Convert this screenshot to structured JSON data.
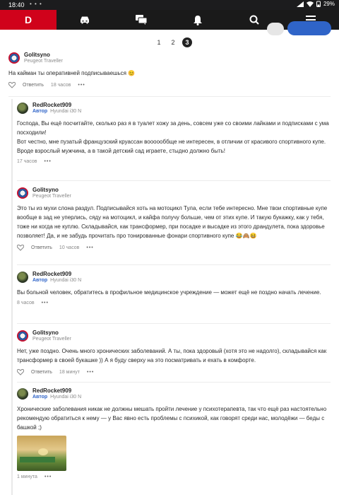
{
  "status_bar": {
    "time": "18:40",
    "battery": "29%",
    "dots": "• • •"
  },
  "navbar": {
    "logo": "D",
    "icons": [
      "car-icon",
      "chat-icon",
      "bell-icon",
      "search-icon",
      "menu-icon"
    ]
  },
  "pagination": {
    "pages": [
      "1",
      "2",
      "3"
    ],
    "active": "3"
  },
  "comments": [
    {
      "author": "Golitsyno",
      "car": "Peugeot Traveller",
      "is_author": false,
      "text": "На кайман ты оперативней подписываешься 😊",
      "reply_label": "Ответить",
      "time": "18 часов",
      "more": "•••"
    },
    {
      "author": "RedRocket909",
      "author_badge": "Автор",
      "car": "Hyundai i30 N",
      "is_author": true,
      "text": "Господа, Вы ещё посчитайте, сколько раз я в туалет хожу за день, совсем уже со своими лайками и подписками с ума посходили!\nВот честно, мне пузатый французский круассан воооооббще не интересен, в отличии от красивого спортивного купе.\nВроде взрослый мужчина, а в такой детский сад играете, стыдно должно быть!",
      "time": "17 часов",
      "more": "•••"
    },
    {
      "author": "Golitsyno",
      "car": "Peugeot Traveller",
      "is_author": false,
      "text": "Это ты из мухи слона раздул. Подписывайся хоть на мотоцикл Тула, если тебе интересно. Мне твои спортивные купе вообще в зад не уперлись, сяду на мотоцикл, и кайфа получу больше, чем от этих купе. И такую букажку, как у тебя, тоже ни когда не куплю. Складывайся, как трансформер, при посадке и высадке из этого драндулета, пока здоровье позволяет! Да, и не забудь прочитать про тонированные фонари спортивного купе 😂🙈😆",
      "reply_label": "Ответить",
      "time": "10 часов",
      "more": "•••"
    },
    {
      "author": "RedRocket909",
      "author_badge": "Автор",
      "car": "Hyundai i30 N",
      "is_author": true,
      "text": "Вы больной человек, обратитесь в профильное медицинское учреждение — может ещё не поздно начать лечение.",
      "time": "8 часов",
      "more": "•••"
    },
    {
      "author": "Golitsyno",
      "car": "Peugeot Traveller",
      "is_author": false,
      "text": "Нет, уже поздно. Очень много хронических заболеваний. А ты, пока здоровый (хотя это не надолго), складывайся как трансформер в своей букашке )) А я буду сверху на это посматривать и ехать в комфорте.",
      "reply_label": "Ответить",
      "time": "18 минут",
      "more": "•••"
    },
    {
      "author": "RedRocket909",
      "author_badge": "Автор",
      "car": "Hyundai i30 N",
      "is_author": true,
      "text": "Хронические заболевания никак не должны мешать пройти лечение у психотерапевта, так что ещё раз настоятельно рекомендую обратиться к нему — у Вас явно есть проблемы с психикой, как говорят среди нас, молодёжи — беды с башкой ;)",
      "time": "1 минута",
      "more": "•••"
    }
  ]
}
